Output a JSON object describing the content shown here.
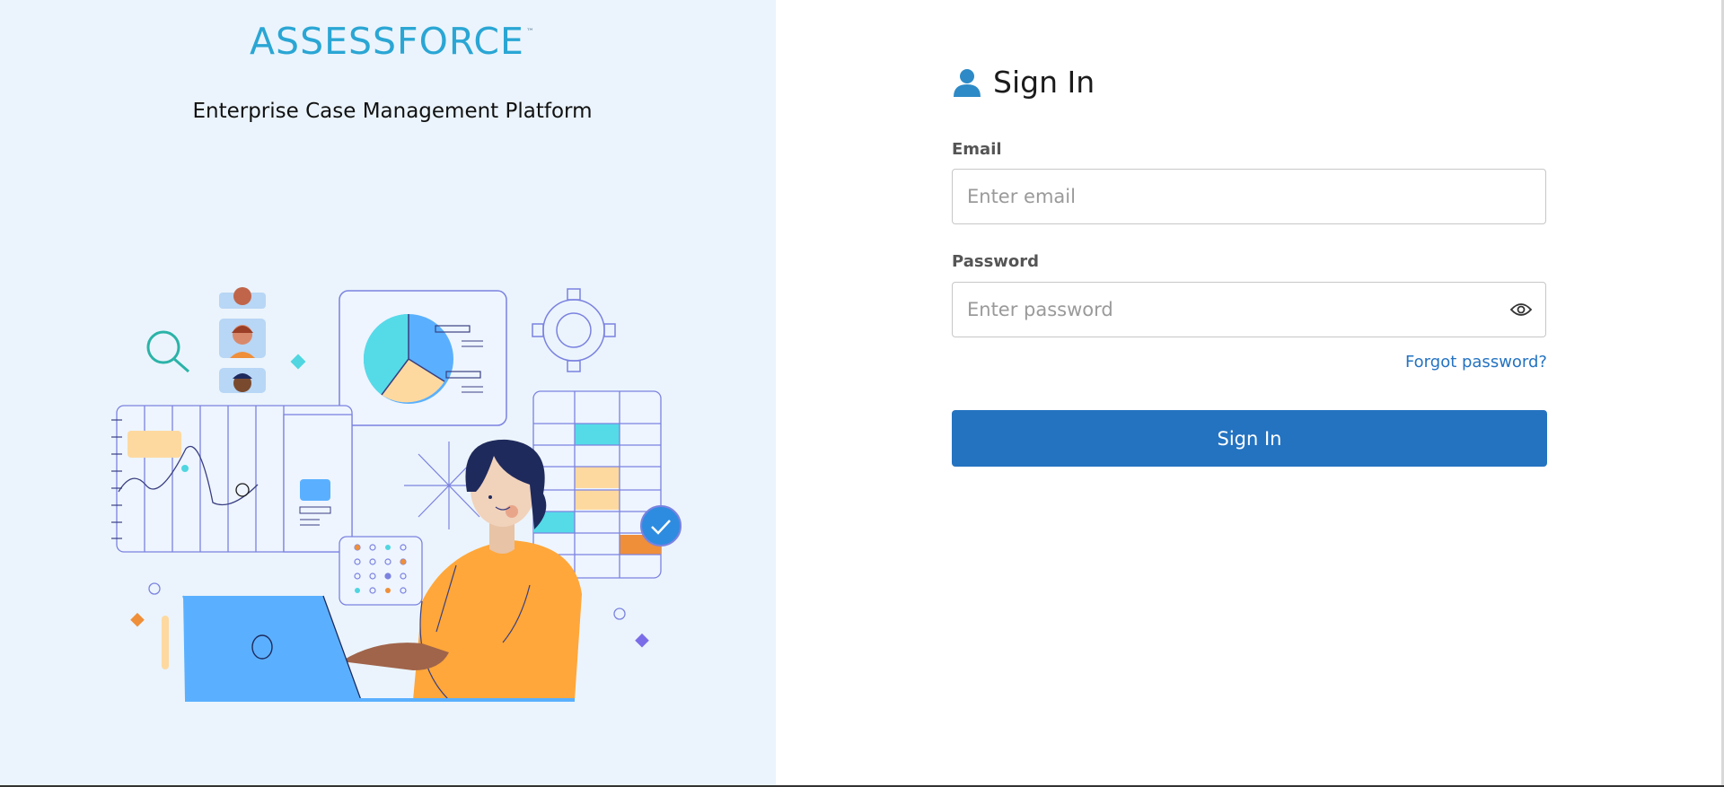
{
  "brand": {
    "logo_text": "ASSESSFORCE",
    "trademark": "™",
    "tagline": "Enterprise Case Management Platform",
    "accent_color": "#2aa6d4"
  },
  "signin": {
    "title": "Sign In",
    "email_label": "Email",
    "email_placeholder": "Enter email",
    "email_value": "",
    "password_label": "Password",
    "password_placeholder": "Enter password",
    "password_value": "",
    "forgot_label": "Forgot password?",
    "submit_label": "Sign In",
    "primary_color": "#2473c1"
  },
  "icons": {
    "user": "user-icon",
    "eye": "eye-icon"
  }
}
